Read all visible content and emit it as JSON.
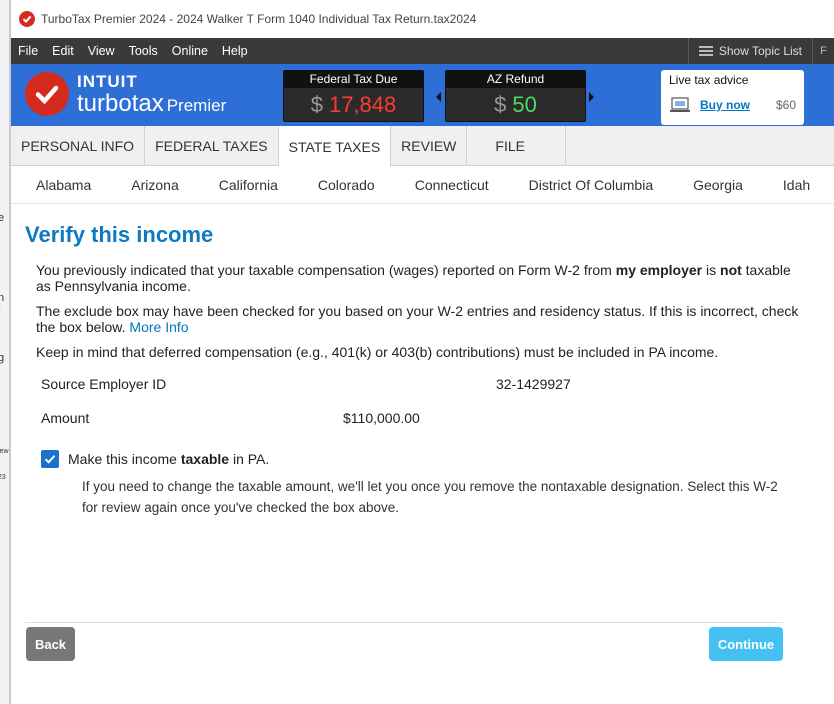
{
  "window": {
    "title": "TurboTax Premier 2024 - 2024 Walker T Form 1040  Individual Tax Return.tax2024"
  },
  "menu": {
    "items": [
      "File",
      "Edit",
      "View",
      "Tools",
      "Online",
      "Help"
    ],
    "topic_list": "Show Topic List",
    "print_fragment": "F"
  },
  "brand": {
    "intuit": "INTUIT",
    "product": "turbotax",
    "edition": "Premier"
  },
  "meters": {
    "federal": {
      "label": "Federal Tax Due",
      "currency": "$",
      "amount": "17,848"
    },
    "state": {
      "label": "AZ Refund",
      "currency": "$",
      "amount": "50"
    }
  },
  "advice": {
    "heading": "Live tax advice",
    "buy_label": "Buy now",
    "price": "$60"
  },
  "tabs": [
    "PERSONAL INFO",
    "FEDERAL TAXES",
    "STATE TAXES",
    "REVIEW",
    "FILE"
  ],
  "states": [
    "Alabama",
    "Arizona",
    "California",
    "Colorado",
    "Connecticut",
    "District Of Columbia",
    "Georgia",
    "Idah"
  ],
  "page": {
    "title": "Verify this income",
    "p1_a": "You previously indicated that your taxable compensation (wages) reported on Form W-2 from ",
    "p1_b": "my employer",
    "p1_c": " is ",
    "p1_d": "not",
    "p1_e": " taxable as Pennsylvania income.",
    "p2": "The exclude box may have been checked for you based on your W-2 entries and residency status. If this is incorrect, check the box below. ",
    "more_info": "More Info",
    "p3": "Keep in mind that deferred compensation (e.g., 401(k) or 403(b) contributions) must be included in PA income.",
    "source_label": "Source Employer ID",
    "source_value": "32-1429927",
    "amount_label": "Amount",
    "amount_value": "$110,000.00",
    "check_a": "Make this income ",
    "check_b": "taxable",
    "check_c": " in PA.",
    "note": "If you need to change the taxable amount, we'll let you once you remove the nontaxable designation. Select this W-2 for review again once you've checked the box above."
  },
  "buttons": {
    "back": "Back",
    "continue": "Continue"
  },
  "behind_fragments": [
    "e",
    "n I",
    "g",
    "iew",
    "23"
  ],
  "colors": {
    "brand_blue": "#2d6fd6",
    "title_blue": "#0f7ac2",
    "continue": "#44c1f2",
    "checkbox": "#1a73c8"
  }
}
